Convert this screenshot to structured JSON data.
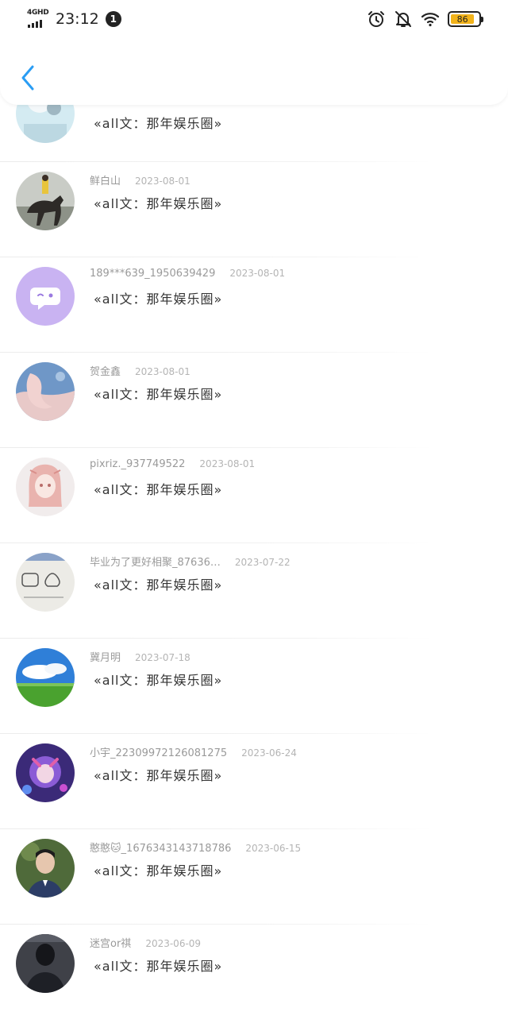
{
  "status_bar": {
    "network": "4GHD",
    "time": "23:12",
    "notification_count": "1",
    "battery": "86",
    "battery_level": 0.86,
    "battery_color": "#f2b31a"
  },
  "header": {
    "back_icon": "chevron-left-icon",
    "accent": "#2a9df4"
  },
  "messages": [
    {
      "username": "",
      "date": "",
      "text": "«all文：那年娱乐圈»",
      "avatar": "light blue photo"
    },
    {
      "username": "鲜白山",
      "date": "2023-08-01",
      "text": "«all文：那年娱乐圈»",
      "avatar": "rider on horse"
    },
    {
      "username": "189***639_1950639429",
      "date": "2023-08-01",
      "text": "«all文：那年娱乐圈»",
      "avatar": "default chat avatar"
    },
    {
      "username": "贺金鑫",
      "date": "2023-08-01",
      "text": "«all文：那年娱乐圈»",
      "avatar": "blue pink illustration"
    },
    {
      "username": "pixriz._937749522",
      "date": "2023-08-01",
      "text": "«all文：那年娱乐圈»",
      "avatar": "anime girl"
    },
    {
      "username": "毕业为了更好相聚_87636…",
      "date": "2023-07-22",
      "text": "«all文：那年娱乐圈»",
      "avatar": "doodle sketch"
    },
    {
      "username": "冀月明",
      "date": "2023-07-18",
      "text": "«all文：那年娱乐圈»",
      "avatar": "blue sky field"
    },
    {
      "username": "小宇_22309972126081275",
      "date": "2023-06-24",
      "text": "«all文：那年娱乐圈»",
      "avatar": "purple game art"
    },
    {
      "username": "憨憨🐱_1676343143718786",
      "date": "2023-06-15",
      "text": "«all文：那年娱乐圈»",
      "avatar": "person photo"
    },
    {
      "username": "迷宫or祺",
      "date": "2023-06-09",
      "text": "«all文：那年娱乐圈»",
      "avatar": "dark portrait"
    }
  ]
}
